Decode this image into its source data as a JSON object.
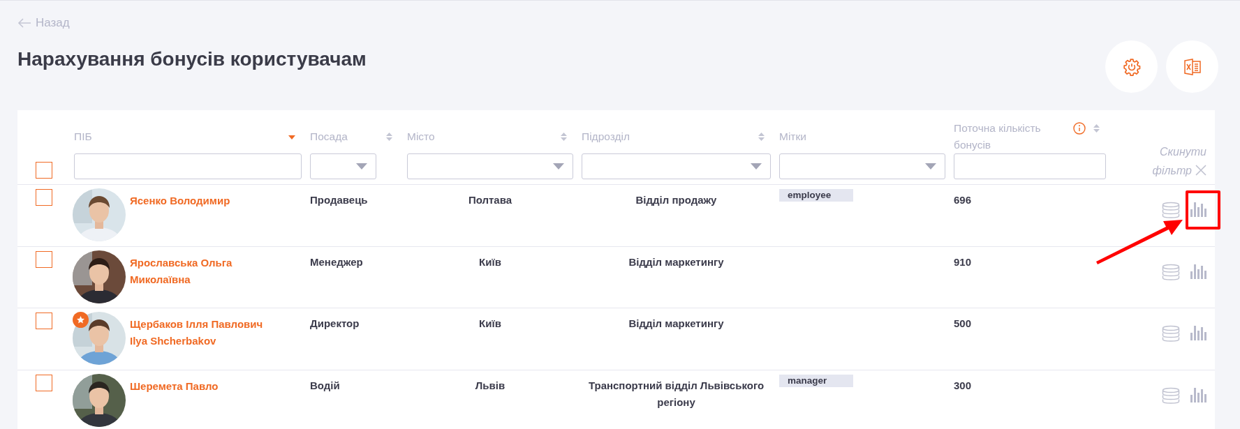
{
  "back_link": {
    "label": "Назад"
  },
  "title": "Нарахування бонусів користувачам",
  "toolbar": [
    {
      "kind": "settings"
    },
    {
      "kind": "excel"
    }
  ],
  "table": {
    "select_all": {
      "checked": false
    },
    "columns": [
      {
        "label": "ПІБ",
        "sort": {
          "kind": "desc"
        },
        "filter": {
          "kind": "text"
        }
      },
      {
        "label": "Посада",
        "sort": {
          "kind": "both"
        },
        "filter": {
          "kind": "select"
        }
      },
      {
        "label": "Місто",
        "sort": {
          "kind": "both"
        },
        "filter": {
          "kind": "select"
        }
      },
      {
        "label": "Підрозділ",
        "sort": {
          "kind": "both"
        },
        "filter": {
          "kind": "select"
        }
      },
      {
        "label": "Мітки",
        "filter": {
          "kind": "select"
        }
      },
      {
        "label": "Поточна кількість бонусів",
        "sort": {
          "kind": "both"
        },
        "filter": {
          "kind": "text"
        },
        "info_icon": {
          "kind": "info"
        }
      }
    ],
    "reset_filter": {
      "label": "Скинути фільтр"
    },
    "rows": [
      {
        "checked": false,
        "avatar": {
          "kind": "picture"
        },
        "featured": false,
        "name": "Ясенко Володимир",
        "position": "Продавець",
        "city": "Полтава",
        "department": "Відділ продажу",
        "tags": [
          "employee"
        ],
        "bonuses": "696",
        "stats_highlighted": true
      },
      {
        "checked": false,
        "avatar": {
          "kind": "picture"
        },
        "featured": false,
        "name": "Ярославська Ольга Миколаївна",
        "position": "Менеджер",
        "city": "Київ",
        "department": "Відділ маркетингу",
        "tags": [],
        "bonuses": "910",
        "stats_highlighted": false
      },
      {
        "checked": false,
        "avatar": {
          "kind": "picture"
        },
        "featured": true,
        "name": "Щербаков Ілля Павлович",
        "alt_name": "Ilya Shcherbakov",
        "position": "Директор",
        "city": "Київ",
        "department": "Відділ маркетингу",
        "tags": [],
        "bonuses": "500",
        "stats_highlighted": false
      },
      {
        "checked": false,
        "avatar": {
          "kind": "picture"
        },
        "featured": false,
        "name": "Шеремета Павло",
        "position": "Водій",
        "city": "Львів",
        "department": "Транспортний відділ Львівського регіону",
        "tags": [
          "manager"
        ],
        "bonuses": "300",
        "stats_highlighted": false
      }
    ]
  }
}
